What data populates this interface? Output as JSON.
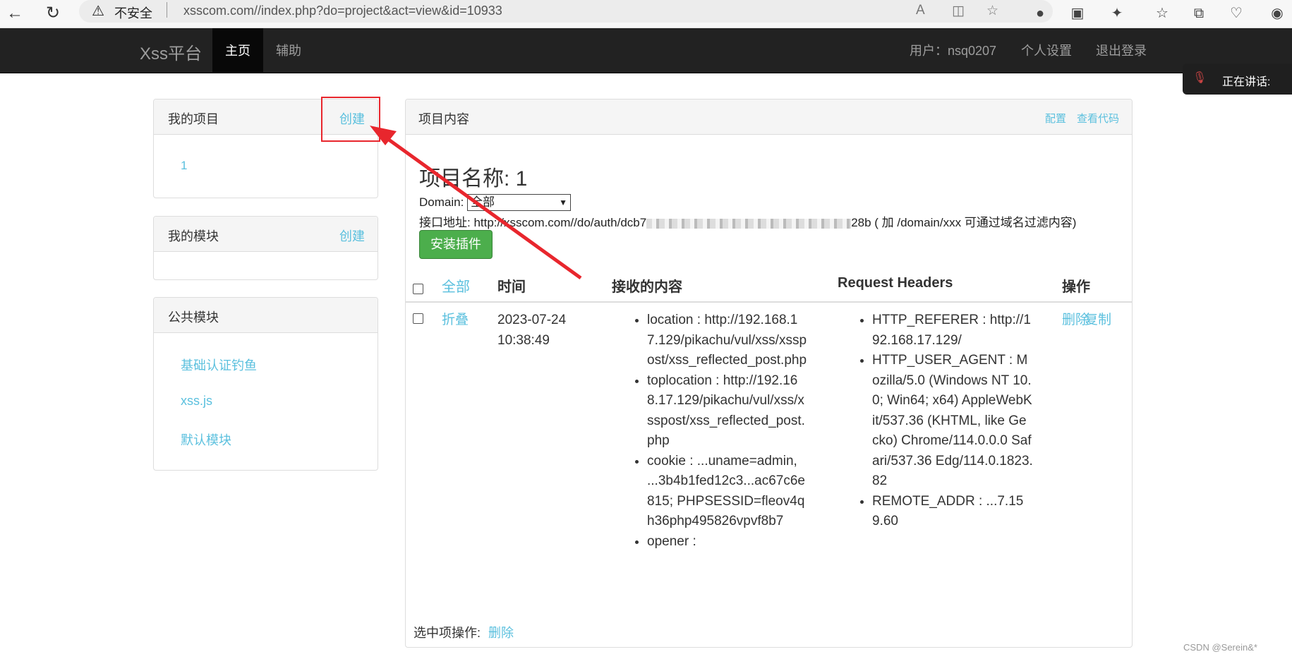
{
  "browser": {
    "insecure_label": "不安全",
    "url": "xsscom.com//index.php?do=project&act=view&id=10933"
  },
  "navbar": {
    "brand": "Xss平台",
    "items": [
      "主页",
      "辅助"
    ],
    "user_label": "用户：nsq0207",
    "settings": "个人设置",
    "logout": "退出登录"
  },
  "talk_widget": {
    "label": "正在讲话:"
  },
  "my_projects": {
    "title": "我的项目",
    "create": "创建",
    "items": [
      "1"
    ]
  },
  "my_modules": {
    "title": "我的模块",
    "create": "创建"
  },
  "public_modules": {
    "title": "公共模块",
    "items": [
      "基础认证钓鱼",
      "xss.js",
      "默认模块"
    ]
  },
  "project": {
    "panel_title": "项目内容",
    "configure": "配置",
    "view_code": "查看代码",
    "name": "项目名称: 1",
    "domain_label": "Domain:",
    "domain_value": "全部",
    "api_prefix": "接口地址: http://xsscom.com//do/auth/dcb7",
    "api_suffix": "28b ( 加 /domain/xxx 可通过域名过滤内容)",
    "install_button": "安装插件",
    "table": {
      "headers": [
        "全部",
        "时间",
        "接收的内容",
        "Request Headers",
        "操作"
      ],
      "row": {
        "fold": "折叠",
        "time": "2023-07-24 10:38:49",
        "content": [
          "location : http://192.168.17.129/pikachu/vul/xss/xsspost/xss_reflected_post.php",
          "toplocation : http://192.168.17.129/pikachu/vul/xss/xsspost/xss_reflected_post.php",
          "cookie : ...uname=admin, ...3b4b1fed12c3...ac67c6e815; PHPSESSID=fleov4qh36php495826vpvf8b7",
          "opener :"
        ],
        "headers": [
          "HTTP_REFERER : http://192.168.17.129/",
          "HTTP_USER_AGENT : Mozilla/5.0 (Windows NT 10.0; Win64; x64) AppleWebKit/537.36 (KHTML, like Gecko) Chrome/114.0.0.0 Safari/537.36 Edg/114.0.1823.82",
          "REMOTE_ADDR : ...7.159.60"
        ],
        "delete": "删除",
        "copy": "复制"
      }
    },
    "selected_ops_label": "选中项操作:",
    "selected_delete": "删除"
  },
  "watermark": "CSDN @Serein&*"
}
